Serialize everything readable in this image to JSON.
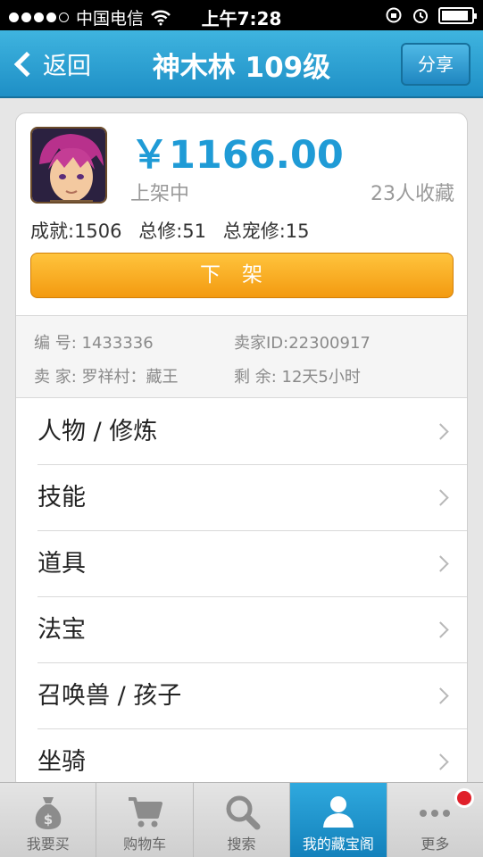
{
  "status_bar": {
    "carrier": "中国电信",
    "time": "上午7:28",
    "battery_level": 0.9
  },
  "nav": {
    "back_label": "返回",
    "title": "神木林 109级",
    "share_label": "分享"
  },
  "item": {
    "price": "￥1166.00",
    "status": "上架中",
    "favorites": "23人收藏",
    "stats": [
      "成就:1506",
      "总修:51",
      "总宠修:15"
    ],
    "unlist_label": "下架"
  },
  "info": {
    "id_label": "编  号:",
    "id_value": "1433336",
    "seller_id_label": "卖家ID:",
    "seller_id_value": "22300917",
    "seller_label": "卖  家:",
    "seller_value": "罗祥村：藏王",
    "remaining_label": "剩  余:",
    "remaining_value": "12天5小时"
  },
  "menu": [
    {
      "label": "人物 / 修炼"
    },
    {
      "label": "技能"
    },
    {
      "label": "道具"
    },
    {
      "label": "法宝"
    },
    {
      "label": "召唤兽 / 孩子"
    },
    {
      "label": "坐骑"
    }
  ],
  "tabs": [
    {
      "label": "我要买",
      "icon": "money-bag-icon"
    },
    {
      "label": "购物车",
      "icon": "cart-icon"
    },
    {
      "label": "搜索",
      "icon": "search-icon"
    },
    {
      "label": "我的藏宝阁",
      "icon": "user-icon",
      "active": true
    },
    {
      "label": "更多",
      "icon": "more-icon"
    }
  ],
  "colors": {
    "accent": "#1f9bd6",
    "nav_bg": "#2aa3d6",
    "button_orange": "#f7a81f",
    "badge_red": "#e0202a"
  }
}
